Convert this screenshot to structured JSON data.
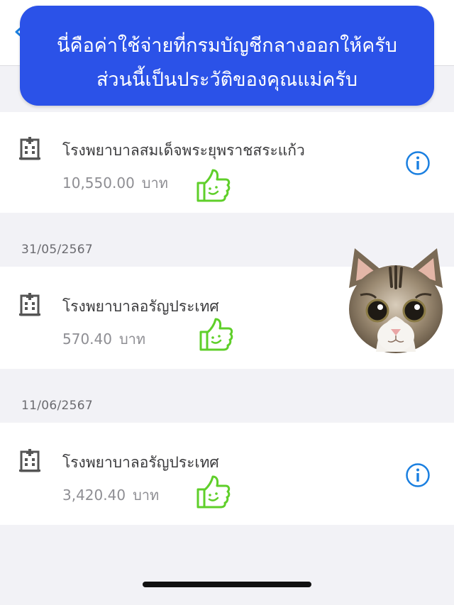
{
  "overlay": {
    "line1": "นี่คือค่าใช้จ่ายที่กรมบัญชีกลางออกให้ครับ",
    "line2": "ส่วนนี้เป็นประวัติของคุณแม่ครับ"
  },
  "records": [
    {
      "date": "",
      "hospital": "โรงพยาบาลสมเด็จพระยุพราชสระแก้ว",
      "amount": "10,550.00",
      "unit": "บาท",
      "has_info": true
    },
    {
      "date": "31/05/2567",
      "hospital": "โรงพยาบาลอรัญประเทศ",
      "amount": "570.40",
      "unit": "บาท",
      "has_info": false
    },
    {
      "date": "11/06/2567",
      "hospital": "โรงพยาบาลอรัญประเทศ",
      "amount": "3,420.40",
      "unit": "บาท",
      "has_info": true
    }
  ],
  "icons": {
    "back": "chevron-left-icon",
    "hospital": "hospital-building-icon",
    "info": "info-circle-icon",
    "sticker": "thumbs-up-smile-sticker",
    "cat": "cat-face-sticker"
  },
  "colors": {
    "accent_blue": "#1a7fe0",
    "banner_blue": "#2b52e8",
    "sticker_green": "#5fcf2a",
    "page_bg": "#f2f2f6"
  }
}
